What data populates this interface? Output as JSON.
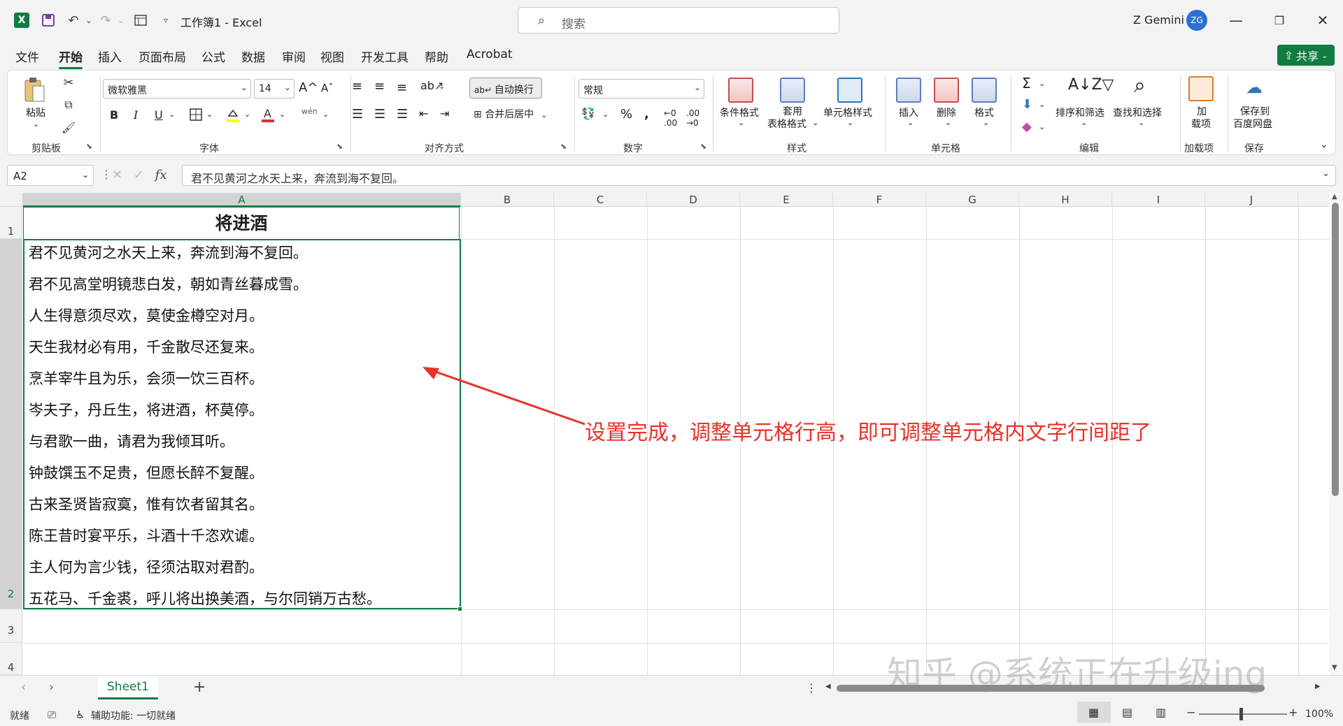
{
  "titlebar": {
    "doc_title": "工作簿1  -  Excel",
    "search_placeholder": "搜索",
    "user_name": "Z Gemini",
    "avatar_initials": "ZG"
  },
  "menu": {
    "tabs": [
      "文件",
      "开始",
      "插入",
      "页面布局",
      "公式",
      "数据",
      "审阅",
      "视图",
      "开发工具",
      "帮助",
      "Acrobat"
    ],
    "active": "开始",
    "share_label": "共享"
  },
  "ribbon": {
    "clipboard": {
      "paste": "粘贴",
      "label": "剪贴板"
    },
    "font": {
      "name": "微软雅黑",
      "size": "14",
      "bold": "B",
      "italic": "I",
      "underline": "U",
      "label": "字体"
    },
    "alignment": {
      "wrap_text": "自动换行",
      "merge_center": "合并后居中",
      "label": "对齐方式"
    },
    "number": {
      "format": "常规",
      "label": "数字"
    },
    "styles": {
      "conditional": "条件格式",
      "table_format_1": "套用",
      "table_format_2": "表格格式",
      "cell_styles": "单元格样式",
      "label": "样式"
    },
    "cells": {
      "insert": "插入",
      "delete": "删除",
      "format": "格式",
      "label": "单元格"
    },
    "editing": {
      "sort_filter": "排序和筛选",
      "find_select": "查找和选择",
      "label": "编辑"
    },
    "addins": {
      "addin_1": "加",
      "addin_2": "载项",
      "label": "加载项"
    },
    "save": {
      "save_1": "保存到",
      "save_2": "百度网盘",
      "label": "保存"
    }
  },
  "formula_bar": {
    "name_box": "A2",
    "fx": "fx",
    "content": "君不见黄河之水天上来，奔流到海不复回。"
  },
  "grid": {
    "columns": [
      "A",
      "B",
      "C",
      "D",
      "E",
      "F",
      "G",
      "H",
      "I",
      "J"
    ],
    "rows": [
      "1",
      "2",
      "3",
      "4"
    ],
    "cell_a1": "将进酒",
    "cell_a2_lines": [
      "君不见黄河之水天上来，奔流到海不复回。",
      "君不见高堂明镜悲白发，朝如青丝暮成雪。",
      "人生得意须尽欢，莫使金樽空对月。",
      "天生我材必有用，千金散尽还复来。",
      "烹羊宰牛且为乐，会须一饮三百杯。",
      "岑夫子，丹丘生，将进酒，杯莫停。",
      "与君歌一曲，请君为我倾耳听。",
      "钟鼓馔玉不足贵，但愿长醉不复醒。",
      "古来圣贤皆寂寞，惟有饮者留其名。",
      "陈王昔时宴平乐，斗酒十千恣欢谑。",
      "主人何为言少钱，径须沽取对君酌。",
      "五花马、千金裘，呼儿将出换美酒，与尔同销万古愁。"
    ],
    "annotation": "设置完成，调整单元格行高，即可调整单元格内文字行间距了",
    "annotation_color": "#e8332c"
  },
  "sheets": {
    "tabs": [
      "Sheet1"
    ],
    "add": "+"
  },
  "watermark": "知乎 @系统正在升级ing",
  "status": {
    "ready": "就绪",
    "accessibility": "辅助功能: 一切就绪",
    "zoom": "100%"
  },
  "colors": {
    "accent": "#107c41",
    "annotation": "#e8332c"
  }
}
